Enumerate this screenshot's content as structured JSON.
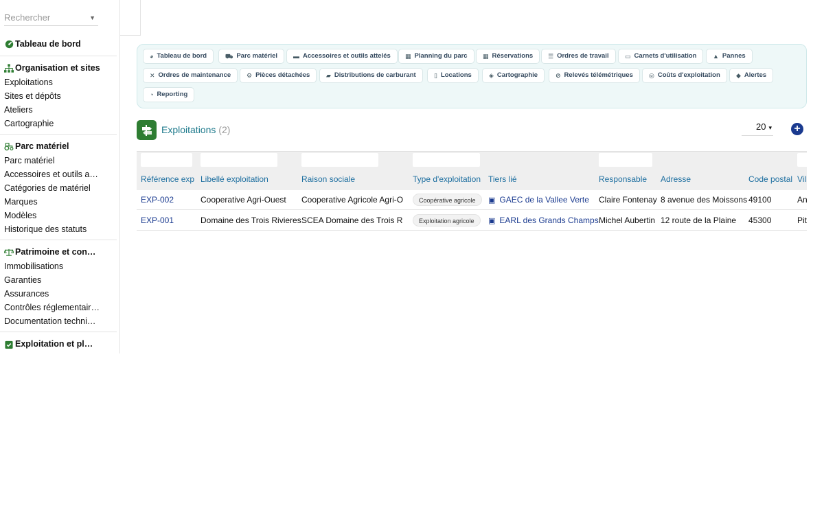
{
  "sidebar": {
    "search_placeholder": "Rechercher",
    "groups": [
      {
        "label": "Tableau de bord",
        "icon": "gauge-icon",
        "items": []
      },
      {
        "label": "Organisation et sites",
        "icon": "sitemap-icon",
        "items": [
          "Exploitations",
          "Sites et dépôts",
          "Ateliers",
          "Cartographie"
        ]
      },
      {
        "label": "Parc matériel",
        "icon": "tractor-icon",
        "items": [
          "Parc matériel",
          "Accessoires et outils attelés",
          "Catégories de matériel",
          "Marques",
          "Modèles",
          "Historique des statuts"
        ]
      },
      {
        "label": "Patrimoine et conformité",
        "icon": "balance-scale-icon",
        "items": [
          "Immobilisations",
          "Garanties",
          "Assurances",
          "Contrôles réglementaires",
          "Documentation technique"
        ]
      },
      {
        "label": "Exploitation et planification",
        "icon": "calendar-check-icon",
        "items": []
      }
    ]
  },
  "nav": {
    "pills": [
      {
        "label": "Tableau de bord",
        "icon": "gauge-icon"
      },
      {
        "label": "Parc matériel",
        "icon": "tractor-icon"
      },
      {
        "label": "Accessoires et outils attelés",
        "icon": "trailer-icon"
      },
      {
        "label": "Planning du parc",
        "icon": "calendar-icon"
      },
      {
        "label": "Réservations",
        "icon": "calendar-check-icon"
      },
      {
        "label": "Ordres de travail",
        "icon": "list-icon"
      },
      {
        "label": "Carnets d'utilisation",
        "icon": "book-icon"
      },
      {
        "label": "Pannes",
        "icon": "warning-icon"
      },
      {
        "label": "Ordres de maintenance",
        "icon": "tools-icon"
      },
      {
        "label": "Pièces détachées",
        "icon": "gear-icon"
      },
      {
        "label": "Distributions de carburant",
        "icon": "fuel-gun-icon"
      },
      {
        "label": "Locations",
        "icon": "file-contract-icon"
      },
      {
        "label": "Cartographie",
        "icon": "map-icon"
      },
      {
        "label": "Relevés télémétriques",
        "icon": "satellite-icon"
      },
      {
        "label": "Coûts d'exploitation",
        "icon": "coins-icon"
      },
      {
        "label": "Alertes",
        "icon": "bell-icon"
      },
      {
        "label": "Reporting",
        "icon": "chart-pie-icon"
      }
    ]
  },
  "section": {
    "title": "Exploitations",
    "count": "(2)",
    "page_size": "20",
    "accent": "#2e7d32"
  },
  "table": {
    "columns": [
      "Référence exploitation",
      "Libellé exploitation",
      "Raison sociale",
      "Type d'exploitation",
      "Tiers lié",
      "Responsable",
      "Adresse",
      "Code postal",
      "Ville"
    ],
    "rows": [
      {
        "ref": "EXP-002",
        "libelle": "Cooperative Agri-Ouest",
        "raison": "Cooperative Agricole Agri-Ouest",
        "type": "Coopérative agricole",
        "tiers": "GAEC de la Vallee Verte",
        "responsable": "Claire Fontenay",
        "adresse": "8 avenue des Moissons",
        "cp": "49100",
        "ville": "Angers"
      },
      {
        "ref": "EXP-001",
        "libelle": "Domaine des Trois Rivieres",
        "raison": "SCEA Domaine des Trois Rivieres",
        "type": "Exploitation agricole",
        "tiers": "EARL des Grands Champs",
        "responsable": "Michel Aubertin",
        "adresse": "12 route de la Plaine",
        "cp": "45300",
        "ville": "Pithiviers"
      }
    ]
  }
}
